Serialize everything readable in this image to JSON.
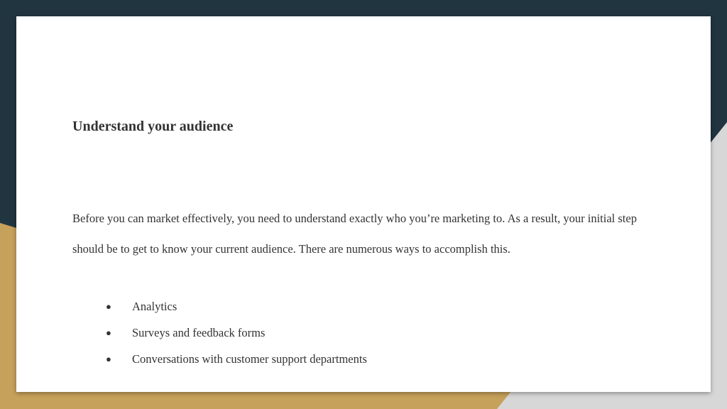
{
  "colors": {
    "dark_navy": "#213540",
    "gold": "#c6a15b",
    "light_gray": "#d7d7d7",
    "slide_background": "#ffffff",
    "text": "#333333"
  },
  "slide": {
    "heading": "Understand your audience",
    "paragraph": "Before you can market effectively, you need to understand exactly who you’re marketing to. As a result, your initial step should be to get to know your current audience. There are numerous ways to accomplish this.",
    "bullet_symbol": "●",
    "bullets": [
      "Analytics",
      "Surveys and feedback forms",
      "Conversations with customer support departments"
    ]
  }
}
